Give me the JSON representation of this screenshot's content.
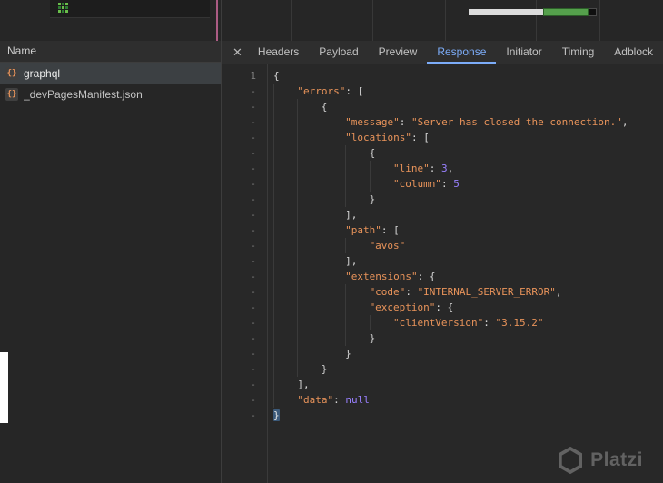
{
  "colors": {
    "bg_panel": "#262626",
    "bg_code": "#282828",
    "bg_toolbar": "#2e2e2e",
    "border": "#3d3d3d",
    "selected_row": "#3c4043",
    "tab_text": "#c3c3c3",
    "accent_blue": "#7cacf8",
    "key_orange": "#e8935a",
    "string_orange": "#e8935a",
    "literal_purple": "#9980ff",
    "gutter_text": "#7d7d7d",
    "indent_guide": "#3a3a3a",
    "waterfall_green": "#55a04c",
    "marker_pink": "#d96fa4",
    "favicon_green": "#6abf4b",
    "bracket_match": "#3c5a7a"
  },
  "sidebar": {
    "header": "Name",
    "file_icon_glyph": "{}",
    "items": [
      {
        "label": "graphql",
        "selected": true
      },
      {
        "label": "_devPagesManifest.json",
        "selected": false
      }
    ]
  },
  "tabs": {
    "close_glyph": "✕",
    "items": [
      {
        "label": "Headers",
        "active": false
      },
      {
        "label": "Payload",
        "active": false
      },
      {
        "label": "Preview",
        "active": false
      },
      {
        "label": "Response",
        "active": true
      },
      {
        "label": "Initiator",
        "active": false
      },
      {
        "label": "Timing",
        "active": false
      },
      {
        "label": "Adblock",
        "active": false
      }
    ]
  },
  "response": {
    "lines": [
      {
        "g": "1",
        "i": 0,
        "t": [
          [
            "p",
            "{"
          ]
        ]
      },
      {
        "g": "-",
        "i": 1,
        "t": [
          [
            "k",
            "\"errors\""
          ],
          [
            "p",
            ": ["
          ]
        ]
      },
      {
        "g": "-",
        "i": 2,
        "t": [
          [
            "p",
            "{"
          ]
        ]
      },
      {
        "g": "-",
        "i": 3,
        "t": [
          [
            "k",
            "\"message\""
          ],
          [
            "p",
            ": "
          ],
          [
            "s",
            "\"Server has closed the connection.\""
          ],
          [
            "p",
            ","
          ]
        ]
      },
      {
        "g": "-",
        "i": 3,
        "t": [
          [
            "k",
            "\"locations\""
          ],
          [
            "p",
            ": ["
          ]
        ]
      },
      {
        "g": "-",
        "i": 4,
        "t": [
          [
            "p",
            "{"
          ]
        ]
      },
      {
        "g": "-",
        "i": 5,
        "t": [
          [
            "k",
            "\"line\""
          ],
          [
            "p",
            ": "
          ],
          [
            "n",
            "3"
          ],
          [
            "p",
            ","
          ]
        ]
      },
      {
        "g": "-",
        "i": 5,
        "t": [
          [
            "k",
            "\"column\""
          ],
          [
            "p",
            ": "
          ],
          [
            "n",
            "5"
          ]
        ]
      },
      {
        "g": "-",
        "i": 4,
        "t": [
          [
            "p",
            "}"
          ]
        ]
      },
      {
        "g": "-",
        "i": 3,
        "t": [
          [
            "p",
            "],"
          ]
        ]
      },
      {
        "g": "-",
        "i": 3,
        "t": [
          [
            "k",
            "\"path\""
          ],
          [
            "p",
            ": ["
          ]
        ]
      },
      {
        "g": "-",
        "i": 4,
        "t": [
          [
            "s",
            "\"avos\""
          ]
        ]
      },
      {
        "g": "-",
        "i": 3,
        "t": [
          [
            "p",
            "],"
          ]
        ]
      },
      {
        "g": "-",
        "i": 3,
        "t": [
          [
            "k",
            "\"extensions\""
          ],
          [
            "p",
            ": {"
          ]
        ]
      },
      {
        "g": "-",
        "i": 4,
        "t": [
          [
            "k",
            "\"code\""
          ],
          [
            "p",
            ": "
          ],
          [
            "s",
            "\"INTERNAL_SERVER_ERROR\""
          ],
          [
            "p",
            ","
          ]
        ]
      },
      {
        "g": "-",
        "i": 4,
        "t": [
          [
            "k",
            "\"exception\""
          ],
          [
            "p",
            ": {"
          ]
        ]
      },
      {
        "g": "-",
        "i": 5,
        "t": [
          [
            "k",
            "\"clientVersion\""
          ],
          [
            "p",
            ": "
          ],
          [
            "s",
            "\"3.15.2\""
          ]
        ]
      },
      {
        "g": "-",
        "i": 4,
        "t": [
          [
            "p",
            "}"
          ]
        ]
      },
      {
        "g": "-",
        "i": 3,
        "t": [
          [
            "p",
            "}"
          ]
        ]
      },
      {
        "g": "-",
        "i": 2,
        "t": [
          [
            "p",
            "}"
          ]
        ]
      },
      {
        "g": "-",
        "i": 1,
        "t": [
          [
            "p",
            "],"
          ]
        ]
      },
      {
        "g": "-",
        "i": 1,
        "t": [
          [
            "k",
            "\"data\""
          ],
          [
            "p",
            ": "
          ],
          [
            "u",
            "null"
          ]
        ]
      },
      {
        "g": "-",
        "i": 0,
        "t": [
          [
            "m",
            "}"
          ]
        ]
      }
    ]
  },
  "watermark": {
    "label": "Platzi"
  }
}
